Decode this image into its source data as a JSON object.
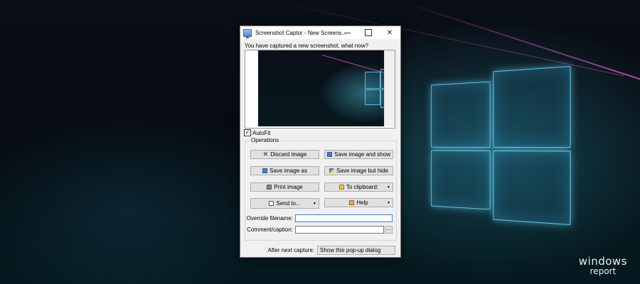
{
  "window": {
    "title": "Screenshot Captor - New Screens...",
    "prompt": "You have captured a new screenshot, what now?",
    "autofit_label": "AutoFit",
    "autofit_checked": true,
    "autofit_mark": "✓"
  },
  "operations": {
    "group_label": "Operations",
    "buttons": {
      "discard": "Discard image",
      "save_show": "Save image and show",
      "save_as": "Save image as",
      "save_hide": "Save image but hide",
      "print": "Print image",
      "clipboard": "To clipboard:",
      "send_to": "Send to...",
      "help": "Help"
    }
  },
  "fields": {
    "override_label": "Override filename:",
    "override_value": "",
    "comment_label": "Comment/caption:",
    "comment_value": "",
    "comment_button": "..."
  },
  "footer": {
    "label": "After next capture:",
    "selected": "Show this pop-up dialog"
  },
  "watermark": {
    "line1": "windows",
    "line2": "report"
  },
  "icons": {
    "app": "monitor-icon",
    "discard": "x-icon",
    "save": "save-icon",
    "print": "printer-icon",
    "clipboard": "clipboard-icon",
    "send": "send-icon",
    "help": "help-icon"
  }
}
